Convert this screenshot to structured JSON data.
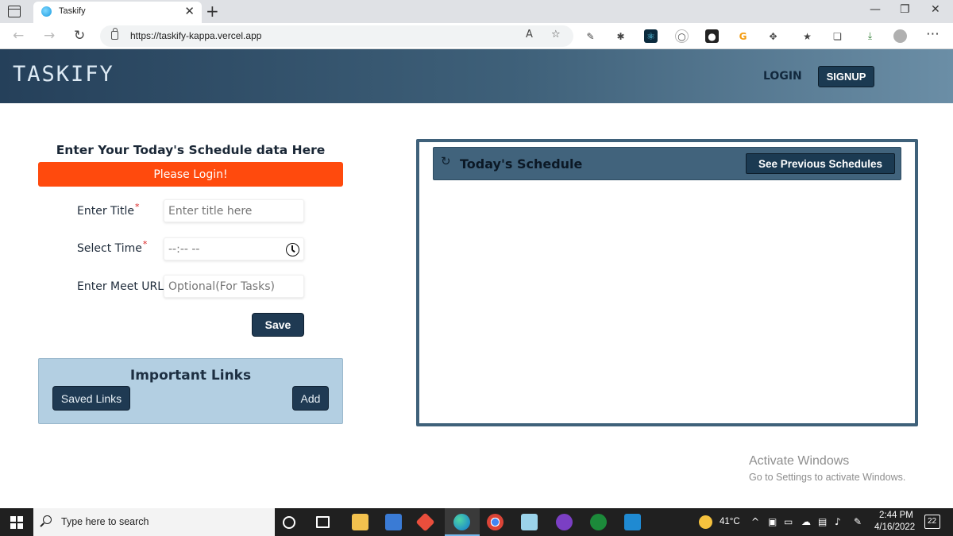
{
  "browser": {
    "tab_title": "Taskify",
    "tab_close": "✕",
    "new_tab": "+",
    "window_controls": {
      "minimize": "—",
      "restore": "❐",
      "close": "✕"
    },
    "url": "https://taskify-kappa.vercel.app",
    "nav": {
      "back": "←",
      "forward": "→",
      "refresh": "↻"
    },
    "menu": "⋯"
  },
  "site": {
    "brand": "TASKIFY",
    "nav": {
      "login": "LOGIN",
      "signup": "SIGNUP"
    }
  },
  "form": {
    "heading": "Enter Your Today's Schedule data Here",
    "alert": "Please Login!",
    "required_mark": "*",
    "fields": {
      "title": {
        "label": "Enter Title",
        "placeholder": "Enter title here"
      },
      "time": {
        "label": "Select Time",
        "placeholder": "--:-- --"
      },
      "meet_url": {
        "label": "Enter Meet URL",
        "placeholder": "Optional(For Tasks)"
      }
    },
    "save_label": "Save"
  },
  "links": {
    "title": "Important Links",
    "saved_label": "Saved Links",
    "add_label": "Add"
  },
  "schedule": {
    "refresh_glyph": "↻",
    "title": "Today's Schedule",
    "previous_label": "See Previous Schedules"
  },
  "watermark": {
    "title": "Activate Windows",
    "subtitle": "Go to Settings to activate Windows."
  },
  "taskbar": {
    "search_placeholder": "Type here to search",
    "weather": "41°C",
    "time": "2:44 PM",
    "date": "4/16/2022",
    "notifications": "22"
  }
}
